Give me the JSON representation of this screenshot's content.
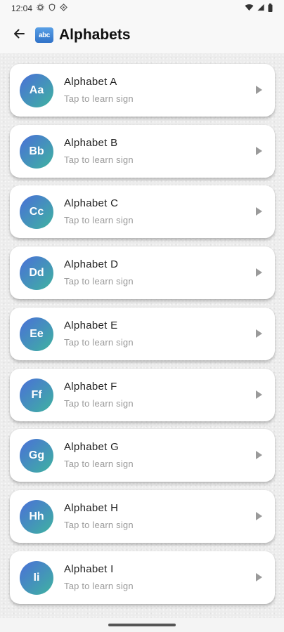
{
  "status_bar": {
    "time": "12:04"
  },
  "app_bar": {
    "title_emoji": "abc",
    "title": "Alphabets"
  },
  "items": [
    {
      "avatar": "Aa",
      "title": "Alphabet A",
      "subtitle": "Tap to learn sign"
    },
    {
      "avatar": "Bb",
      "title": "Alphabet B",
      "subtitle": "Tap to learn sign"
    },
    {
      "avatar": "Cc",
      "title": "Alphabet C",
      "subtitle": "Tap to learn sign"
    },
    {
      "avatar": "Dd",
      "title": "Alphabet D",
      "subtitle": "Tap to learn sign"
    },
    {
      "avatar": "Ee",
      "title": "Alphabet E",
      "subtitle": "Tap to learn sign"
    },
    {
      "avatar": "Ff",
      "title": "Alphabet F",
      "subtitle": "Tap to learn sign"
    },
    {
      "avatar": "Gg",
      "title": "Alphabet G",
      "subtitle": "Tap to learn sign"
    },
    {
      "avatar": "Hh",
      "title": "Alphabet H",
      "subtitle": "Tap to learn sign"
    },
    {
      "avatar": "Ii",
      "title": "Alphabet I",
      "subtitle": "Tap to learn sign"
    }
  ],
  "icons": {
    "back": "arrow-left-icon",
    "row_action": "play-arrow-icon",
    "status": [
      "settings-icon",
      "shield-icon",
      "location-icon",
      "wifi-icon",
      "signal-icon",
      "battery-icon"
    ]
  }
}
